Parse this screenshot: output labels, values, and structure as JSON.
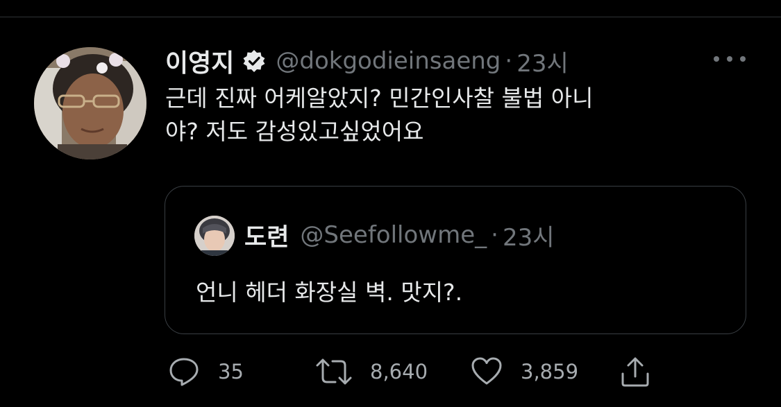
{
  "tweet": {
    "display_name": "이영지",
    "verified_icon": "verified-badge-icon",
    "handle": "@dokgodieinsaeng",
    "separator": "·",
    "time": "23시",
    "more_icon": "more-options-icon",
    "text": "근데 진짜 어케알았지? 민간인사찰 불법 아니\n야? 저도 감성있고싶었어요"
  },
  "quote": {
    "display_name": "도련",
    "handle": "@Seefollowme_",
    "separator": "·",
    "time": "23시",
    "text": "언니 헤더 화장실 벽. 맛지?."
  },
  "actions": {
    "reply": {
      "icon": "reply-icon",
      "count": "35"
    },
    "retweet": {
      "icon": "retweet-icon",
      "count": "8,640"
    },
    "like": {
      "icon": "like-icon",
      "count": "3,859"
    },
    "share": {
      "icon": "share-icon"
    }
  },
  "colors": {
    "background": "#000000",
    "text_primary": "#e7e9ea",
    "text_secondary": "#71767b",
    "border": "#3a3f44"
  }
}
